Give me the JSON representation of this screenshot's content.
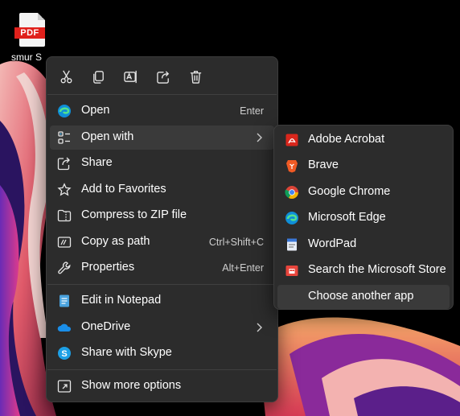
{
  "desktop": {
    "file_badge": "PDF",
    "file_label": "smur S"
  },
  "toolbar": {
    "actions": [
      "cut-icon",
      "copy-icon",
      "rename-icon",
      "share-icon",
      "delete-icon"
    ]
  },
  "menu": {
    "items": [
      {
        "label": "Open",
        "shortcut": "Enter"
      },
      {
        "label": "Open with"
      },
      {
        "label": "Share"
      },
      {
        "label": "Add to Favorites"
      },
      {
        "label": "Compress to ZIP file"
      },
      {
        "label": "Copy as path",
        "shortcut": "Ctrl+Shift+C"
      },
      {
        "label": "Properties",
        "shortcut": "Alt+Enter"
      },
      {
        "label": "Edit in Notepad"
      },
      {
        "label": "OneDrive"
      },
      {
        "label": "Share with Skype"
      },
      {
        "label": "Show more options"
      }
    ]
  },
  "submenu": {
    "items": [
      {
        "label": "Adobe Acrobat"
      },
      {
        "label": "Brave"
      },
      {
        "label": "Google Chrome"
      },
      {
        "label": "Microsoft Edge"
      },
      {
        "label": "WordPad"
      },
      {
        "label": "Search the Microsoft Store"
      },
      {
        "label": "Choose another app"
      }
    ]
  },
  "colors": {
    "menu_bg": "#2c2c2c",
    "hover_bg": "#3a3a3a",
    "accent_blue": "#4cc2ff",
    "pdf_red": "#e0201b"
  }
}
